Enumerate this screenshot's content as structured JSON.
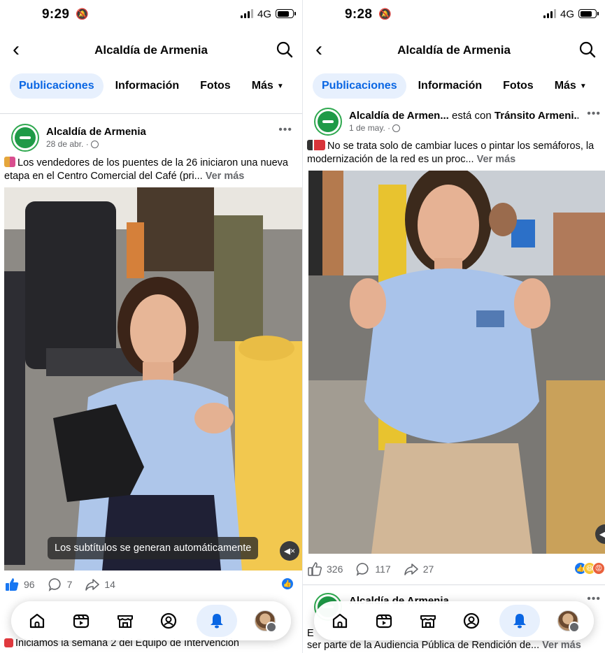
{
  "left": {
    "status": {
      "time": "9:29",
      "network": "4G"
    },
    "page_title": "Alcaldía de Armenia",
    "tabs": {
      "posts": "Publicaciones",
      "info": "Información",
      "photos": "Fotos",
      "more": "Más"
    },
    "post": {
      "author": "Alcaldía de Armenia",
      "date": "28 de abr. ·",
      "text": "Los vendedores de los puentes de la 26 iniciaron una nueva etapa en el Centro Comercial del Café (pri...",
      "see_more": "Ver más",
      "caption": "Los subtítulos se generan automáticamente",
      "reactions": "96",
      "comments": "7",
      "shares": "14"
    },
    "next_post_text": "Iniciamos la semana 2 del Equipo de Intervención"
  },
  "right": {
    "status": {
      "time": "9:28",
      "network": "4G"
    },
    "page_title": "Alcaldía de Armenia",
    "tabs": {
      "posts": "Publicaciones",
      "info": "Información",
      "photos": "Fotos",
      "more": "Más"
    },
    "post": {
      "author": "Alcaldía de Armen...",
      "with_text": "está con",
      "tagged": "Tránsito Armeni....",
      "date": "1 de may. ·",
      "text": "No se trata solo de cambiar luces o pintar los semáforos, la modernización de la red es un proc...",
      "see_more": "Ver más",
      "reactions": "326",
      "comments": "117",
      "shares": "27"
    },
    "next_post": {
      "author": "Alcaldía de Armenia",
      "prefix": "E",
      "text": "ser parte de la Audiencia Pública de Rendición de...",
      "see_more": "Ver más"
    }
  },
  "icons": {
    "back": "chevron-left-icon",
    "search": "search-icon",
    "home": "home-icon",
    "video": "video-icon",
    "marketplace": "marketplace-icon",
    "profile": "profile-icon",
    "notifications": "bell-icon"
  },
  "colors": {
    "accent": "#0a66e3",
    "tab_active_bg": "#e7f0fd",
    "like_blue": "#1877f2",
    "page_green": "#1f9a47"
  }
}
